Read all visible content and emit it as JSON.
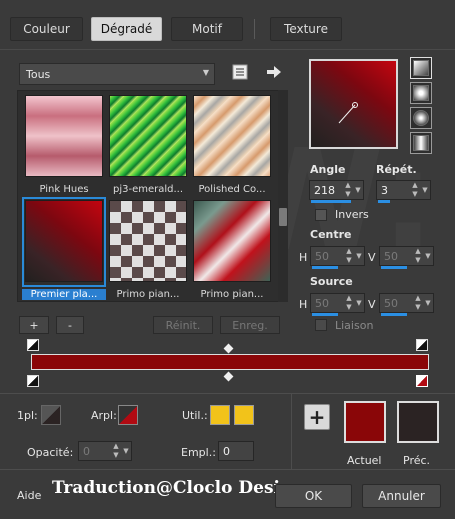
{
  "tabs": [
    {
      "label": "Couleur"
    },
    {
      "label": "Dégradé"
    },
    {
      "label": "Motif"
    },
    {
      "label": "Texture"
    }
  ],
  "gallery": {
    "filter_value": "Tous",
    "items": [
      {
        "label": "Pink Hues"
      },
      {
        "label": "pj3-emerald..."
      },
      {
        "label": "Polished Co..."
      },
      {
        "label": "Premier pla..."
      },
      {
        "label": "Primo pian..."
      },
      {
        "label": "Primo pian..."
      }
    ],
    "add_label": "+",
    "remove_label": "-",
    "reset_label": "Réinit.",
    "save_label": "Enreg."
  },
  "settings": {
    "angle_label": "Angle",
    "angle_value": "218",
    "repeat_label": "Répét.",
    "repeat_value": "3",
    "invert_label": "Invers",
    "center_label": "Centre",
    "center_h_label": "H",
    "center_h_value": "50",
    "center_v_label": "V",
    "center_v_value": "50",
    "source_label": "Source",
    "source_h_label": "H",
    "source_h_value": "50",
    "source_v_label": "V",
    "source_v_value": "50",
    "link_label": "Liaison"
  },
  "stops": {
    "fg_label": "1pl:",
    "bg_label": "Arpl:",
    "user_label": "Util.:",
    "opacity_label": "Opacité:",
    "opacity_value": "0",
    "location_label": "Empl.:",
    "location_value": "0"
  },
  "colors": {
    "current_label": "Actuel",
    "previous_label": "Préc.",
    "current_color": "#8a0608",
    "previous_color": "#2b2323",
    "user_color": "#f2c31a",
    "accent": "#2b8fe3"
  },
  "footer": {
    "help_label": "Aide",
    "ok_label": "OK",
    "cancel_label": "Annuler",
    "watermark_text": "Traduction@Cloclo Design"
  },
  "icons": {
    "list_view": "list-icon",
    "arrow": "arrow-right-icon",
    "add": "plus-icon"
  }
}
